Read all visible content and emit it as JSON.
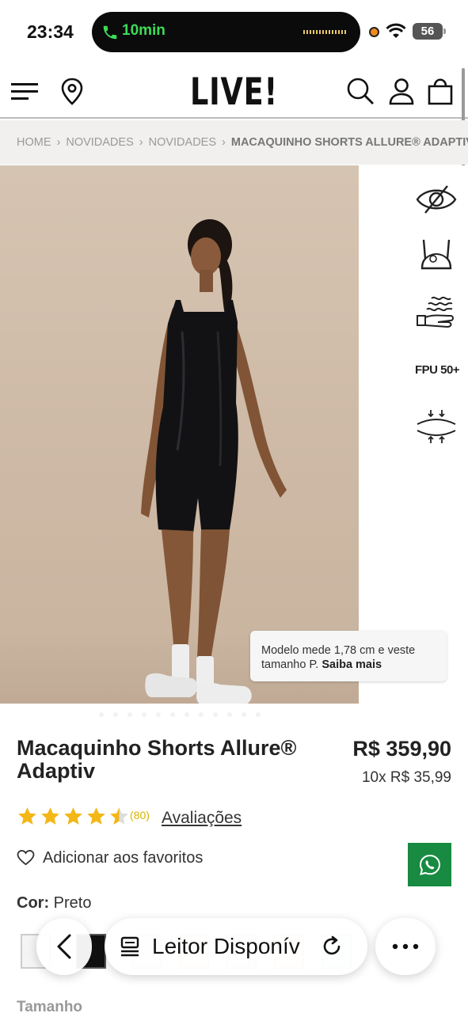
{
  "status_bar": {
    "time": "23:34",
    "call_timer": "10min",
    "battery": "56"
  },
  "header": {
    "logo": "LIVE!",
    "icons": [
      "menu-icon",
      "location-pin-icon",
      "search-icon",
      "account-icon",
      "shopping-bag-icon"
    ]
  },
  "breadcrumb": {
    "items": [
      "HOME",
      "NOVIDADES",
      "NOVIDADES"
    ],
    "current": "MACAQUINHO SHORTS ALLURE® ADAPTIV",
    "separator": "›"
  },
  "product_image": {
    "feature_icons": [
      "opacity-eye-icon",
      "sports-bra-support-icon",
      "breathable-fabric-icon",
      "fpu50-uv-protection",
      "compression-icon"
    ],
    "fpu_label": "FPU 50+",
    "tooltip_text": "Modelo mede 1,78 cm e veste tamanho P.",
    "tooltip_link": "Saiba mais"
  },
  "product": {
    "name": "Macaquinho Shorts Allure® Adaptiv",
    "price": "R$ 359,90",
    "installments": "10x R$ 35,99",
    "rating_stars": 4.5,
    "rating_count": "(80)",
    "reviews_link": "Avaliações",
    "favorite_label": "Adicionar aos favoritos",
    "color_label": "Cor:",
    "color_value": "Preto",
    "size_label": "Tamanho"
  },
  "swatches": {
    "colors": [
      "#f4f4f4",
      "#111111",
      "#e6e9f2",
      "#f3e1dc",
      "#eeeeee",
      "#f2e0da",
      "#dfe3ee"
    ]
  },
  "browser_bar": {
    "reader_label": "Leitor Disponív",
    "icons": [
      "back-chevron-icon",
      "reader-icon",
      "reload-icon",
      "more-icon"
    ]
  },
  "colors": {
    "whatsapp_green": "#188a41",
    "star_gold": "#f3b718",
    "call_green": "#3ddc57"
  }
}
